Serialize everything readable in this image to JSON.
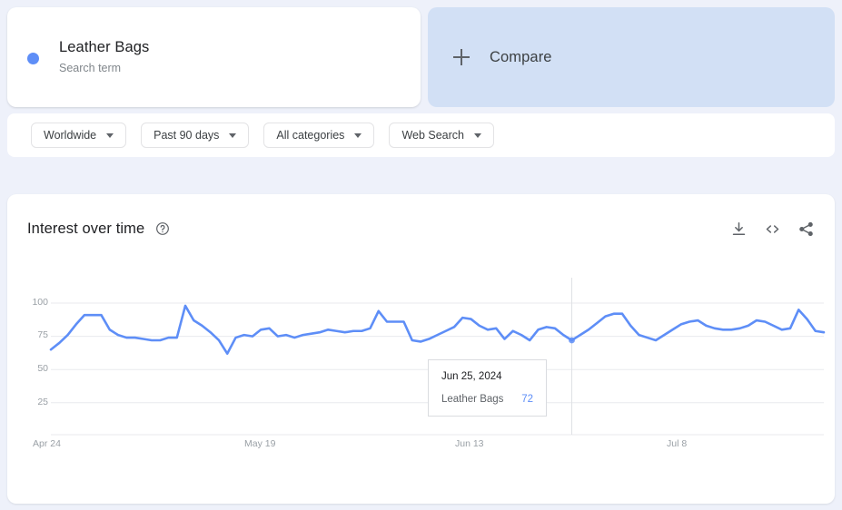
{
  "term_card": {
    "title": "Leather Bags",
    "subtitle": "Search term",
    "dot_color": "#5e8ef7"
  },
  "compare_card": {
    "label": "Compare",
    "plus_icon": "plus-icon",
    "background": "#d2e0f5"
  },
  "filters": [
    {
      "label": "Worldwide",
      "name": "location-filter"
    },
    {
      "label": "Past 90 days",
      "name": "time-range-filter"
    },
    {
      "label": "All categories",
      "name": "category-filter"
    },
    {
      "label": "Web Search",
      "name": "search-type-filter"
    }
  ],
  "chart_card": {
    "title": "Interest over time",
    "help_icon": "help-circle-icon",
    "actions": [
      {
        "name": "download-icon",
        "label": "Download"
      },
      {
        "name": "embed-code-icon",
        "label": "Embed"
      },
      {
        "name": "share-icon",
        "label": "Share"
      }
    ]
  },
  "tooltip": {
    "date": "Jun 25, 2024",
    "series_name": "Leather Bags",
    "value": "72",
    "value_color": "#5e8ef7"
  },
  "chart_data": {
    "type": "line",
    "title": "Interest over time",
    "xlabel": "",
    "ylabel": "",
    "ylim": [
      0,
      100
    ],
    "yticks": [
      100,
      75,
      50,
      25
    ],
    "xticks": [
      "Apr 24",
      "May 19",
      "Jun 13",
      "Jul 8"
    ],
    "xtick_positions": [
      0,
      0.275,
      0.55,
      0.825
    ],
    "grid": true,
    "legend": false,
    "line_color": "#5e8ef7",
    "line_width": 2.6,
    "highlight": {
      "x_index": 62,
      "date": "Jun 25, 2024",
      "value": 72
    },
    "series": [
      {
        "name": "Leather Bags",
        "values": [
          65,
          70,
          76,
          84,
          91,
          91,
          91,
          80,
          76,
          74,
          74,
          73,
          72,
          72,
          74,
          74,
          98,
          87,
          83,
          78,
          72,
          62,
          74,
          76,
          75,
          80,
          81,
          75,
          76,
          74,
          76,
          77,
          78,
          80,
          79,
          78,
          79,
          79,
          81,
          94,
          86,
          86,
          86,
          72,
          71,
          73,
          76,
          79,
          82,
          89,
          88,
          83,
          80,
          81,
          73,
          79,
          76,
          72,
          80,
          82,
          81,
          76,
          72,
          76,
          80,
          85,
          90,
          92,
          92,
          83,
          76,
          74,
          72,
          76,
          80,
          84,
          86,
          87,
          83,
          81,
          80,
          80,
          81,
          83,
          87,
          86,
          83,
          80,
          81,
          95,
          88,
          79,
          78
        ]
      }
    ]
  }
}
